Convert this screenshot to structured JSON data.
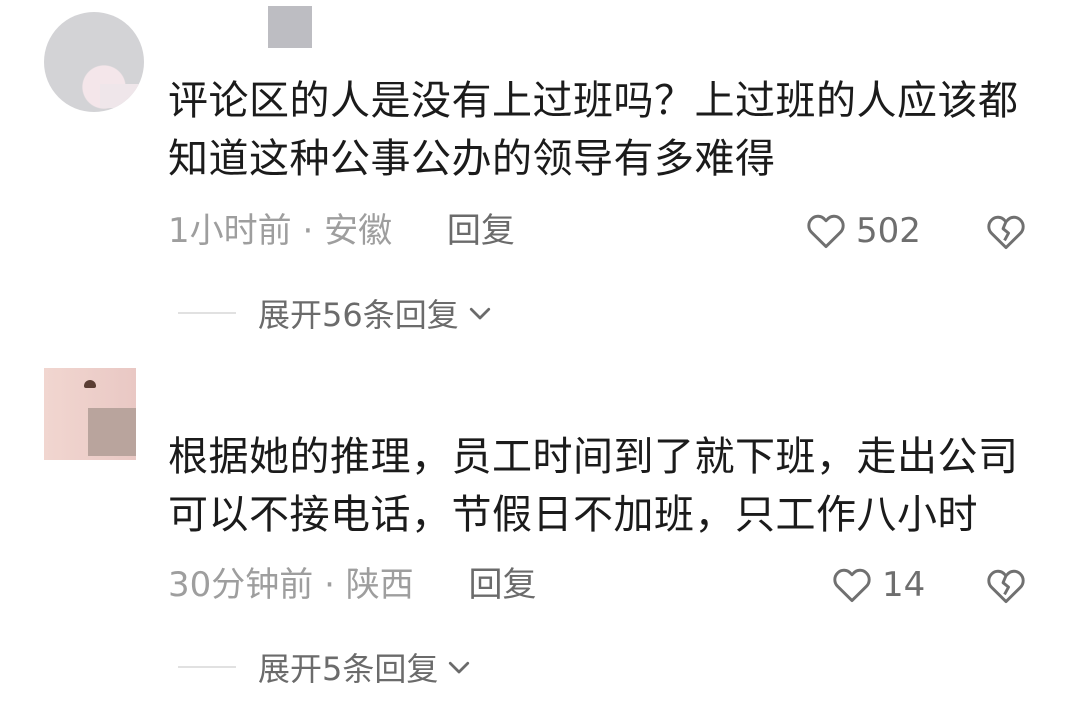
{
  "comments": [
    {
      "text": "评论区的人是没有上过班吗？上过班的人应该都知道这种公事公办的领导有多难得",
      "time": "1小时前",
      "separator": "·",
      "location": "安徽",
      "reply_label": "回复",
      "likes": "502",
      "expand_label": "展开56条回复"
    },
    {
      "text": "根据她的推理，员工时间到了就下班，走出公司可以不接电话，节假日不加班，只工作八小时",
      "time": "30分钟前",
      "separator": "·",
      "location": "陕西",
      "reply_label": "回复",
      "likes": "14",
      "expand_label": "展开5条回复"
    }
  ],
  "icons": {
    "like": "heart-outline-icon",
    "dislike": "broken-heart-icon",
    "expand": "chevron-down-icon"
  },
  "colors": {
    "text_primary": "#1b1b1b",
    "text_secondary": "#9e9e9e",
    "action": "#6b6b6b"
  }
}
